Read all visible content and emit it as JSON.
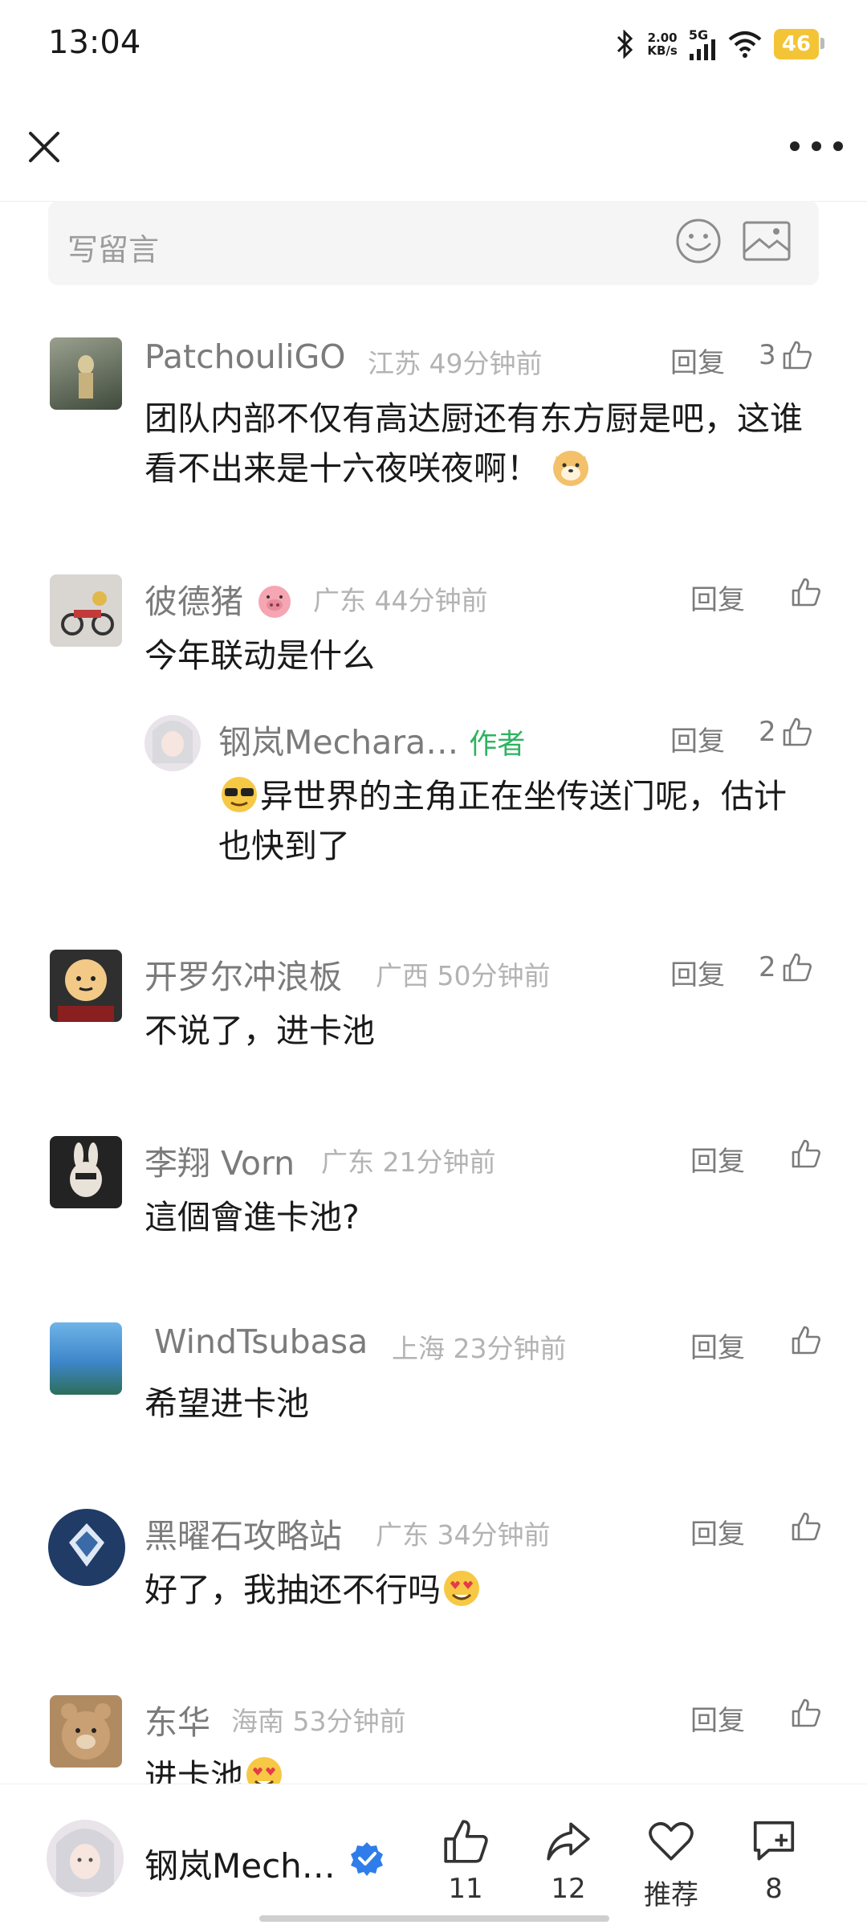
{
  "status_bar": {
    "time": "13:04",
    "net_speed_value": "2.00",
    "net_speed_unit": "KB/s",
    "network": "5G",
    "battery": "46",
    "icons": [
      "bluetooth-icon",
      "signal-icon",
      "wifi-icon",
      "battery-icon"
    ]
  },
  "header": {
    "close_icon": "close-icon",
    "more_icon": "more-icon"
  },
  "comment_input": {
    "placeholder": "写留言",
    "icons": [
      "emoji-icon",
      "image-icon"
    ]
  },
  "reply_label": "回复",
  "comments": [
    {
      "name": "PatchouliGO",
      "location": "江苏",
      "time": "49分钟前",
      "likes": "3",
      "text": "团队内部不仅有高达厨还有东方厨是吧，这谁看不出来是十六夜咲夜啊！"
    },
    {
      "name": "彼德猪",
      "location": "广东",
      "time": "44分钟前",
      "likes": "",
      "text": "今年联动是什么",
      "reply": {
        "name": "钢岚Mechara…",
        "tag": "作者",
        "likes": "2",
        "text": "异世界的主角正在坐传送门呢，估计也快到了"
      }
    },
    {
      "name": "开罗尔冲浪板",
      "location": "广西",
      "time": "50分钟前",
      "likes": "2",
      "text": "不说了，进卡池"
    },
    {
      "name": "李翔 Vorn",
      "location": "广东",
      "time": "21分钟前",
      "likes": "",
      "text": "這個會進卡池?"
    },
    {
      "name": "WindTsubasa",
      "location": "上海",
      "time": "23分钟前",
      "likes": "",
      "text": "希望进卡池"
    },
    {
      "name": "黑曜石攻略站",
      "location": "广东",
      "time": "34分钟前",
      "likes": "",
      "text": "好了，我抽还不行吗"
    },
    {
      "name": "东华",
      "location": "海南",
      "time": "53分钟前",
      "likes": "",
      "text": "进卡池"
    }
  ],
  "bottom_bar": {
    "author": "钢岚Mech…",
    "likes": "11",
    "shares": "12",
    "recommend_label": "推荐",
    "comments": "8"
  },
  "colors": {
    "author_tag": "#2eb360",
    "battery": "#f4c437",
    "verified": "#2f7dea"
  }
}
